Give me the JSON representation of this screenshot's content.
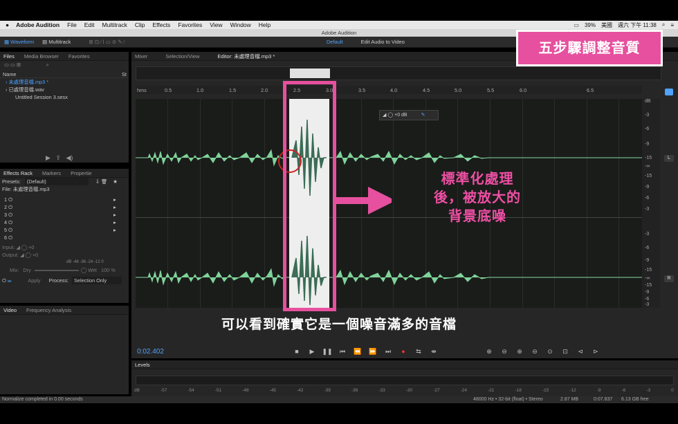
{
  "menubar": {
    "items": [
      "Adobe Audition",
      "File",
      "Edit",
      "Multitrack",
      "Clip",
      "Effects",
      "Favorites",
      "View",
      "Window",
      "Help"
    ],
    "battery": "39%",
    "input_lang": "美國",
    "clock": "週六 下午 11:38"
  },
  "window_title": "Adobe Audition",
  "toolbar": {
    "waveform": "Waveform",
    "multitrack": "Multitrack",
    "workspace": "Default",
    "edit_video": "Edit Audio to Video"
  },
  "files_panel": {
    "tabs": [
      "Files",
      "Media Browser",
      "Favorites"
    ],
    "col_name": "Name",
    "col_status": "St",
    "items": [
      "未處理音檔.mp3 *",
      "已處理音檔.wav",
      "Untitled Session 3.sesx"
    ]
  },
  "effects_rack": {
    "tabs": [
      "Effects Rack",
      "Markers",
      "Propertie"
    ],
    "presets_label": "Presets:",
    "preset_value": "(Default)",
    "file_label": "File: 未處理音檔.mp3",
    "slots": [
      "1",
      "2",
      "3",
      "4",
      "5",
      "6"
    ],
    "input_label": "Input:",
    "input_value": "+0",
    "output_label": "Output:",
    "output_value": "+0",
    "meter_ticks": "dB  -48  -36  -24  -12   0",
    "mix_label": "Mix:",
    "dry": "Dry",
    "wet": "Wet",
    "wet_pct": "100 %",
    "apply": "Apply",
    "process_label": "Process:",
    "process_value": "Selection Only"
  },
  "video_panel": {
    "tabs": [
      "Video",
      "Frequency Analysis"
    ]
  },
  "editor": {
    "tabs": [
      "Mixer",
      "Selection/View",
      "Editor: 未處理音檔.mp3 *"
    ],
    "ruler_unit": "hms",
    "ruler_ticks": [
      "0.5",
      "1.0",
      "1.5",
      "2.0",
      "2.5",
      "3.0",
      "3.5",
      "4.0",
      "4.5",
      "5.0",
      "5.5",
      "6.0",
      "6.5"
    ],
    "hud_gain": "+0 dB",
    "db_label": "dB",
    "db_ticks_l": [
      "-3",
      "-6",
      "-9",
      "-15",
      "-∞",
      "-15",
      "-9",
      "-6",
      "-3"
    ],
    "db_ticks_r": [
      "-3",
      "-6",
      "-9",
      "-15",
      "-∞",
      "-15",
      "-9",
      "-6",
      "-3"
    ],
    "channel_l": "L",
    "channel_r": "R"
  },
  "overlay": {
    "badge": "五步驟調整音質",
    "callout_lines": [
      "標準化處理",
      "後，被放大的",
      "背景底噪"
    ],
    "subtitle": "可以看到確實它是一個噪音滿多的音檔"
  },
  "transport": {
    "timecode": "0:02.402"
  },
  "levels": {
    "title": "Levels",
    "ticks": [
      "dB",
      "-57",
      "-54",
      "-51",
      "-48",
      "-45",
      "-42",
      "-39",
      "-36",
      "-33",
      "-30",
      "-27",
      "-24",
      "-21",
      "-18",
      "-15",
      "-12",
      "-9",
      "-6",
      "-3",
      "0"
    ]
  },
  "status": {
    "message": "Normalize completed in 0.00 seconds",
    "format": "48000 Hz • 32-bit (float) • Stereo",
    "size": "2.87 MB",
    "duration": "0:07.837",
    "free": "6.13 GB free"
  },
  "colors": {
    "accent_blue": "#4fa3ff",
    "wave_green": "#7fd39a",
    "overlay_pink": "#e6509e"
  }
}
